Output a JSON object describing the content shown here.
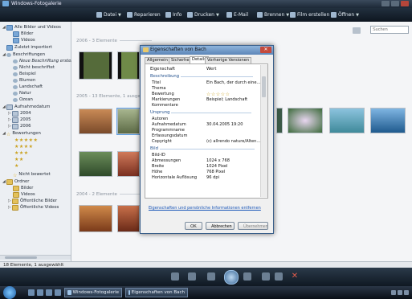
{
  "window": {
    "title": "Windows-Fotogalerie"
  },
  "toolbar": {
    "items": [
      {
        "label": "Datei",
        "icon": "file-icon"
      },
      {
        "label": "Reparieren",
        "icon": "repair-icon"
      },
      {
        "label": "Info",
        "icon": "info-icon"
      },
      {
        "label": "Drucken",
        "icon": "print-icon"
      },
      {
        "label": "E-Mail",
        "icon": "email-icon"
      },
      {
        "label": "Brennen",
        "icon": "burn-icon"
      },
      {
        "label": "Film erstellen",
        "icon": "movie-icon"
      },
      {
        "label": "Öffnen",
        "icon": "open-icon"
      }
    ]
  },
  "search": {
    "placeholder": "Suchen"
  },
  "sidebar": {
    "items": [
      {
        "label": "Alle Bilder und Videos",
        "icon": "gallery-icon"
      },
      {
        "label": "Bilder",
        "icon": "pictures-icon"
      },
      {
        "label": "Videos",
        "icon": "videos-icon"
      },
      {
        "label": "Zuletzt importiert",
        "icon": "recent-icon"
      },
      {
        "label": "Beschriftungen",
        "icon": "tags-icon"
      },
      {
        "label": "Neue Beschriftung erstelle",
        "icon": "new-tag-icon"
      },
      {
        "label": "Nicht beschriftet",
        "icon": "tag-icon"
      },
      {
        "label": "Beispiel",
        "icon": "tag-icon"
      },
      {
        "label": "Blumen",
        "icon": "tag-icon"
      },
      {
        "label": "Landschaft",
        "icon": "tag-icon"
      },
      {
        "label": "Natur",
        "icon": "tag-icon"
      },
      {
        "label": "Ozean",
        "icon": "tag-icon"
      },
      {
        "label": "Aufnahmedatum",
        "icon": "calendar-icon"
      },
      {
        "label": "2004",
        "icon": "calendar-icon"
      },
      {
        "label": "2005",
        "icon": "calendar-icon"
      },
      {
        "label": "2006",
        "icon": "calendar-icon"
      },
      {
        "label": "Bewertungen",
        "icon": "star-icon"
      },
      {
        "label": "Nicht bewertet",
        "icon": "star-icon"
      },
      {
        "label": "Ordner",
        "icon": "folder-icon"
      },
      {
        "label": "Bilder",
        "icon": "folder-icon"
      },
      {
        "label": "Videos",
        "icon": "folder-icon"
      },
      {
        "label": "Öffentliche Bilder",
        "icon": "folder-icon"
      },
      {
        "label": "Öffentliche Videos",
        "icon": "folder-icon"
      }
    ],
    "rating_rows": [
      "★★★★★",
      "★★★★",
      "★★★",
      "★★",
      "★"
    ]
  },
  "groups": [
    {
      "label": "2006 - 3 Elemente"
    },
    {
      "label": "2005 - 13 Elemente, 1 ausgewählt"
    },
    {
      "label": "2004 - 2 Elemente"
    }
  ],
  "statusbar": {
    "text": "18 Elemente, 1 ausgewählt"
  },
  "taskbar": {
    "tasks": [
      {
        "label": "Windows-Fotogalerie"
      },
      {
        "label": "Eigenschaften von Bach"
      }
    ]
  },
  "dialog": {
    "title": "Eigenschaften von Bach",
    "tabs": [
      "Allgemein",
      "Sicherheit",
      "Details",
      "Vorherige Versionen"
    ],
    "active_tab": "Details",
    "headers": {
      "property": "Eigenschaft",
      "value": "Wert"
    },
    "sections": [
      {
        "name": "Beschreibung",
        "rows": [
          {
            "name": "Titel",
            "value": "Ein Bach, der durch eine..."
          },
          {
            "name": "Thema",
            "value": ""
          },
          {
            "name": "Bewertung",
            "value": "☆☆☆☆☆"
          },
          {
            "name": "Markierungen",
            "value": "Beispiel; Landschaft"
          },
          {
            "name": "Kommentare",
            "value": ""
          }
        ]
      },
      {
        "name": "Ursprung",
        "rows": [
          {
            "name": "Autoren",
            "value": ""
          },
          {
            "name": "Aufnahmedatum",
            "value": "30.04.2005 19:20"
          },
          {
            "name": "Programmname",
            "value": ""
          },
          {
            "name": "Erfassungsdatum",
            "value": ""
          },
          {
            "name": "Copyright",
            "value": "(c) allrendo nature/Alten..."
          }
        ]
      },
      {
        "name": "Bild",
        "rows": [
          {
            "name": "Bild-ID",
            "value": ""
          },
          {
            "name": "Abmessungen",
            "value": "1024 x 768"
          },
          {
            "name": "Breite",
            "value": "1024 Pixel"
          },
          {
            "name": "Höhe",
            "value": "768 Pixel"
          },
          {
            "name": "Horizontale Auflösung",
            "value": "96 dpi"
          }
        ]
      }
    ],
    "link": "Eigenschaften und persönliche Informationen entfernen",
    "buttons": {
      "ok": "OK",
      "cancel": "Abbrechen",
      "apply": "Übernehmen"
    }
  },
  "colors": {
    "accent": "#5c86b8",
    "toolbar": "#1c2836",
    "link": "#1a56b8"
  }
}
